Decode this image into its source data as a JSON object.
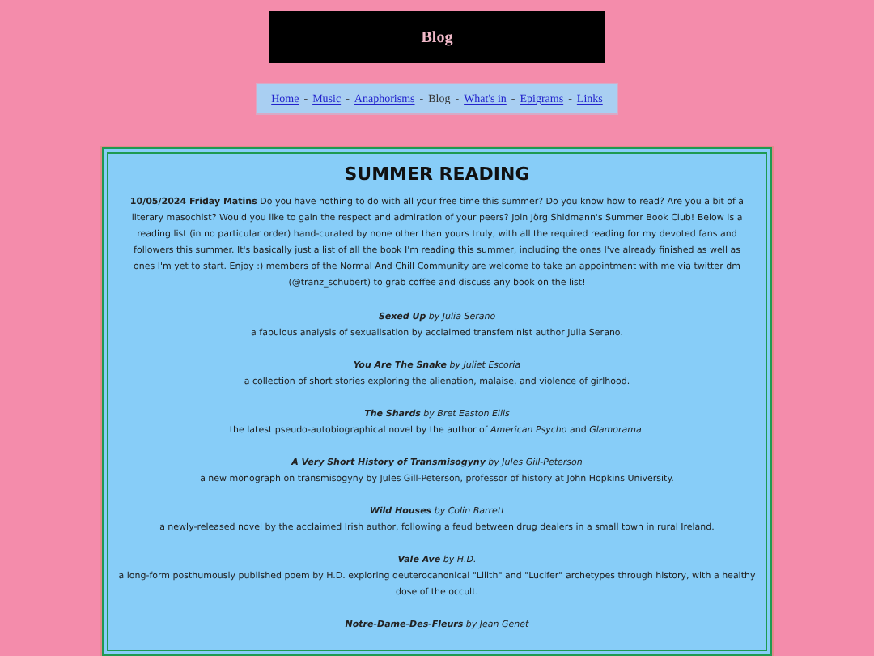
{
  "header": {
    "title": "Blog"
  },
  "nav": [
    {
      "label": "Home",
      "selected": false
    },
    {
      "label": "Music",
      "selected": false
    },
    {
      "label": "Anaphorisms",
      "selected": false
    },
    {
      "label": "Blog",
      "selected": true
    },
    {
      "label": "What's in",
      "selected": false
    },
    {
      "label": "Epigrams",
      "selected": false
    },
    {
      "label": "Links",
      "selected": false
    }
  ],
  "nav_separator": "-",
  "post": {
    "title": "SUMMER READING",
    "intro": "**10/05/2024 Friday Matins** Do you have nothing to do with all your free time this summer? Do you know how to read? Are you a bit of a literary masochist? Would you like to gain the respect and admiration of your peers? Join Jörg Shidmann's Summer Book Club! Below is a reading list (in no particular order) hand-curated by none other than yours truly, with all the required reading for my devoted fans and followers this summer. It's basically just a list of all the book I'm reading this summer, including the ones I've already finished as well as ones I'm yet to start. Enjoy :) members of the Normal And Chill Community are welcome to take an appointment with me via twitter dm (@tranz_schubert) to grab coffee and discuss any book on the list!",
    "books": [
      {
        "heading": "**Sexed Up** by Julia Serano",
        "description": "a fabulous analysis of sexualisation by acclaimed transfeminist author Julia Serano."
      },
      {
        "heading": "**You Are The Snake** by Juliet Escoria",
        "description": "a collection of short stories exploring the alienation, malaise, and violence of girlhood."
      },
      {
        "heading": "**The Shards** by Bret Easton Ellis",
        "description": "the latest pseudo-autobiographical novel by the author of *American Psycho* and *Glamorama*."
      },
      {
        "heading": "**A Very Short History of Transmisogyny** by Jules Gill-Peterson",
        "description": "a new monograph on transmisogyny by Jules Gill-Peterson, professor of history at John Hopkins University."
      },
      {
        "heading": "**Wild Houses** by Colin Barrett",
        "description": "a newly-released novel by the acclaimed Irish author, following a feud between drug dealers in a small town in rural Ireland."
      },
      {
        "heading": "**Vale Ave** by H.D.",
        "description": "a long-form posthumously published poem by H.D. exploring deuterocanonical \"Lilith\" and \"Lucifer\" archetypes through history, with a healthy dose of the occult."
      },
      {
        "heading": "**Notre-Dame-Des-Fleurs** by Jean Genet"
      }
    ]
  }
}
